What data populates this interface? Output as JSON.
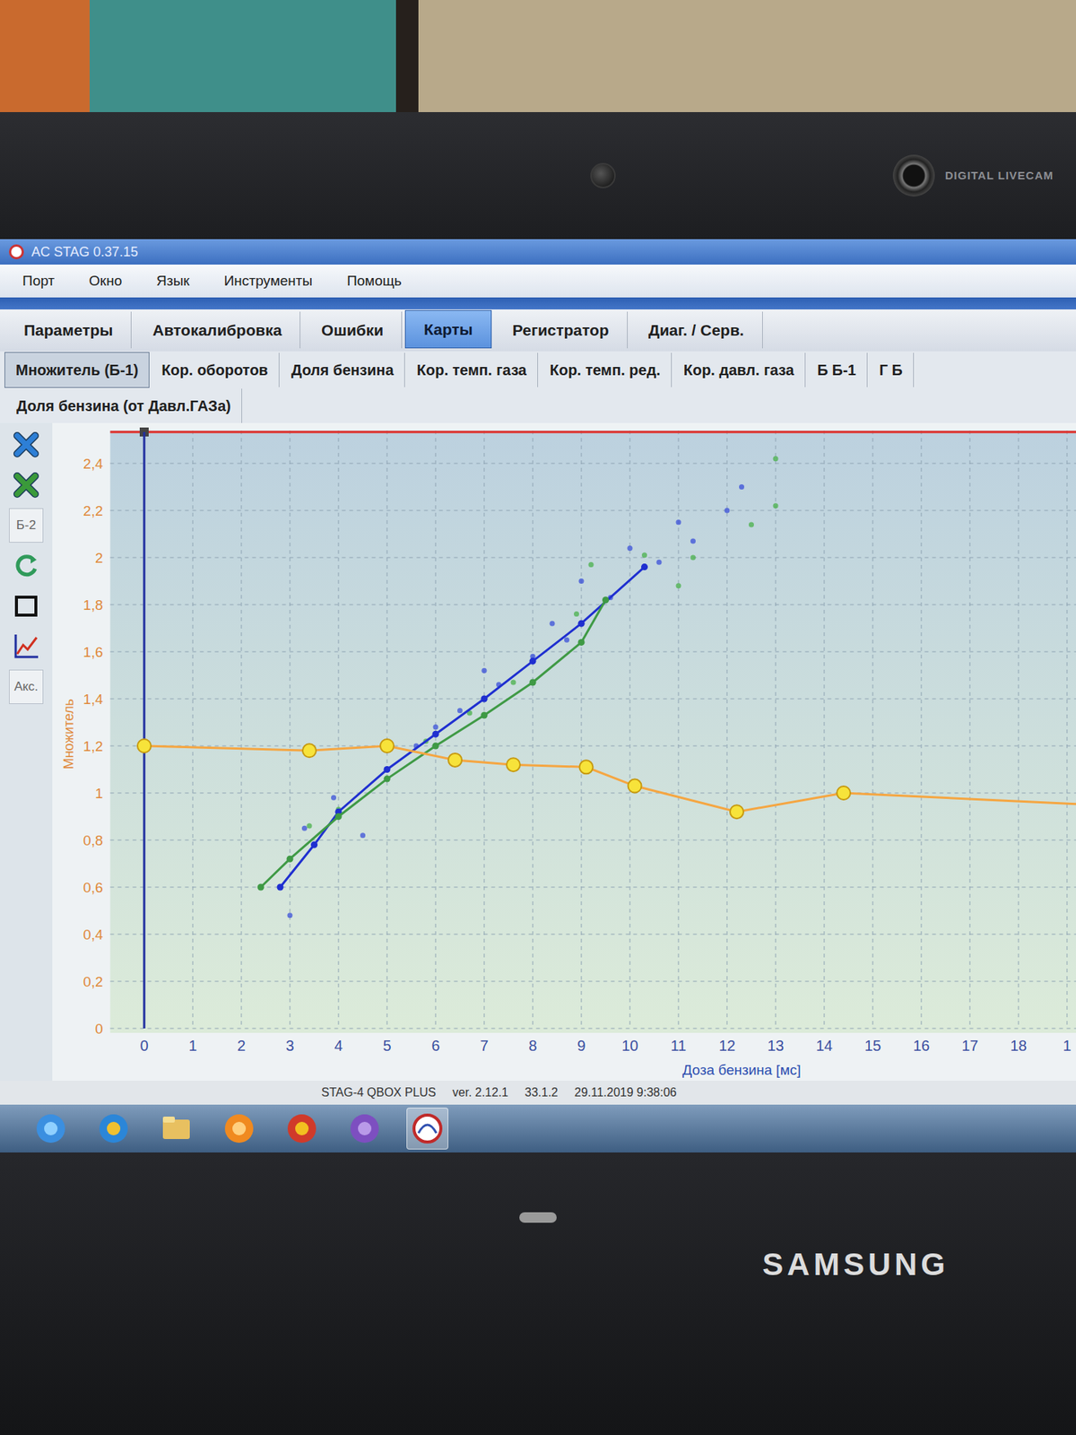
{
  "window": {
    "title": "AC STAG 0.37.15"
  },
  "bezel": {
    "camera": "DIGITAL LIVECAM",
    "brand": "SAMSUNG"
  },
  "menu": [
    "Порт",
    "Окно",
    "Язык",
    "Инструменты",
    "Помощь"
  ],
  "tabs": [
    {
      "label": "Параметры",
      "selected": false
    },
    {
      "label": "Автокалибровка",
      "selected": false
    },
    {
      "label": "Ошибки",
      "selected": false
    },
    {
      "label": "Карты",
      "selected": true
    },
    {
      "label": "Регистратор",
      "selected": false
    },
    {
      "label": "Диаг. / Серв.",
      "selected": false
    }
  ],
  "subtabs": [
    {
      "label": "Множитель (Б-1)",
      "selected": true
    },
    {
      "label": "Кор. оборотов",
      "selected": false
    },
    {
      "label": "Доля бензина",
      "selected": false
    },
    {
      "label": "Кор. темп. газа",
      "selected": false
    },
    {
      "label": "Кор. темп. ред.",
      "selected": false
    },
    {
      "label": "Кор. давл. газа",
      "selected": false
    },
    {
      "label": "Б Б-1",
      "selected": false
    },
    {
      "label": "Г Б",
      "selected": false
    }
  ],
  "subtabs_row2": [
    {
      "label": "Доля бензина (от Давл.ГАЗа)",
      "selected": false
    }
  ],
  "toolbar": [
    {
      "kind": "xblue"
    },
    {
      "kind": "xgreen"
    },
    {
      "kind": "text",
      "label": "Б-2"
    },
    {
      "kind": "refresh"
    },
    {
      "kind": "frame"
    },
    {
      "kind": "graph"
    },
    {
      "kind": "text",
      "label": "Акс."
    }
  ],
  "chart": {
    "y_label": "Множитель",
    "x_label": "Доза бензина [мс]",
    "y_ticks": [
      "0",
      "0,2",
      "0,4",
      "0,6",
      "0,8",
      "1",
      "1,2",
      "1,4",
      "1,6",
      "1,8",
      "2",
      "2,2",
      "2,4"
    ],
    "x_ticks": [
      "0",
      "1",
      "2",
      "3",
      "4",
      "5",
      "6",
      "7",
      "8",
      "9",
      "10",
      "11",
      "12",
      "13",
      "14",
      "15",
      "16",
      "17",
      "18",
      "1"
    ],
    "series": [
      {
        "kind": "map",
        "color": "#f5a642",
        "x": [
          0,
          3.4,
          5.0,
          6.4,
          7.6,
          9.1,
          10.1,
          12.2,
          14.4,
          19.5
        ],
        "y": [
          1.2,
          1.18,
          1.2,
          1.14,
          1.12,
          1.11,
          1.03,
          0.92,
          1.0,
          0.95
        ]
      },
      {
        "kind": "scatter",
        "color": "#3a4fd8",
        "x": [
          3.0,
          2.8,
          3.3,
          3.9,
          5.0,
          5.6,
          6.5,
          7.0,
          8.0,
          8.4,
          9.0,
          9.6,
          10.0,
          10.6,
          11.0,
          11.3,
          12.0,
          12.3,
          4.5,
          6.0,
          7.3,
          8.7
        ],
        "y": [
          0.48,
          0.6,
          0.85,
          0.98,
          1.1,
          1.2,
          1.35,
          1.52,
          1.58,
          1.72,
          1.9,
          1.83,
          2.04,
          1.98,
          2.15,
          2.07,
          2.2,
          2.3,
          0.82,
          1.28,
          1.46,
          1.65
        ]
      },
      {
        "kind": "scatter",
        "color": "#48b04a",
        "x": [
          2.4,
          3.0,
          3.4,
          4.0,
          5.8,
          6.7,
          7.6,
          9.2,
          10.3,
          11.0,
          11.3,
          12.5,
          13.0,
          13.0,
          8.9
        ],
        "y": [
          0.6,
          0.72,
          0.86,
          0.93,
          1.22,
          1.34,
          1.47,
          1.97,
          2.01,
          1.88,
          2.0,
          2.14,
          2.42,
          2.22,
          1.76
        ]
      },
      {
        "kind": "trend",
        "color": "#1f2fd0",
        "x": [
          2.8,
          3.5,
          4.0,
          5.0,
          6.0,
          7.0,
          8.0,
          9.0,
          10.3
        ],
        "y": [
          0.6,
          0.78,
          0.92,
          1.1,
          1.25,
          1.4,
          1.56,
          1.72,
          1.96
        ]
      },
      {
        "kind": "trend",
        "color": "#3f9a45",
        "x": [
          2.4,
          3.0,
          4.0,
          5.0,
          6.0,
          7.0,
          8.0,
          9.0,
          9.5
        ],
        "y": [
          0.6,
          0.72,
          0.9,
          1.06,
          1.2,
          1.33,
          1.47,
          1.64,
          1.82
        ]
      }
    ]
  },
  "status": [
    "STAG-4 QBOX PLUS",
    "ver. 2.12.1",
    "33.1.2",
    "29.11.2019 9:38:06"
  ],
  "taskbar": [
    {
      "kind": "start",
      "selected": false
    },
    {
      "kind": "ie",
      "selected": false
    },
    {
      "kind": "folder",
      "selected": false
    },
    {
      "kind": "media",
      "selected": false
    },
    {
      "kind": "chrome",
      "selected": false
    },
    {
      "kind": "viber",
      "selected": false
    },
    {
      "kind": "stag",
      "selected": true
    }
  ]
}
